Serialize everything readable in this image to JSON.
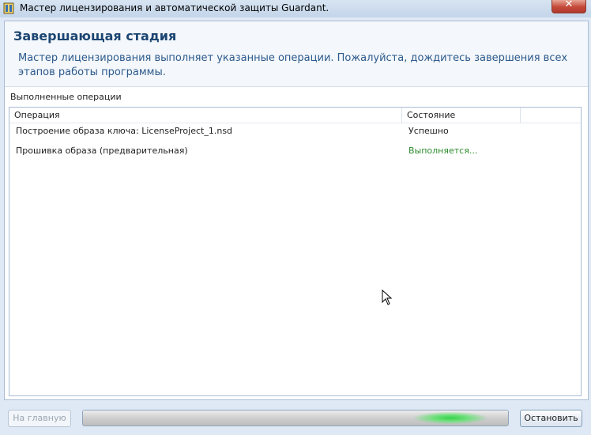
{
  "window": {
    "title": "Мастер лицензирования и автоматической защиты Guardant.",
    "close_icon": "close-icon",
    "app_icon": "guardant-app-icon"
  },
  "header": {
    "title": "Завершающая стадия",
    "description": "Мастер лицензирования выполняет указанные операции. Пожалуйста, дождитесь завершения всех этапов работы программы."
  },
  "operations": {
    "label": "Выполненные операции",
    "columns": [
      "Операция",
      "Состояние",
      ""
    ],
    "rows": [
      {
        "operation": "Построение образа ключа: LicenseProject_1.nsd",
        "status": "Успешно"
      },
      {
        "operation": "Прошивка образа (предварительная)",
        "status": "Выполняется..."
      }
    ]
  },
  "footer": {
    "home_label": "На главную",
    "stop_label": "Остановить",
    "progress_indeterminate": true
  },
  "colors": {
    "status_running": "#2d8a2d",
    "title_color": "#1d4672",
    "progress_glow": "#35d24a"
  }
}
